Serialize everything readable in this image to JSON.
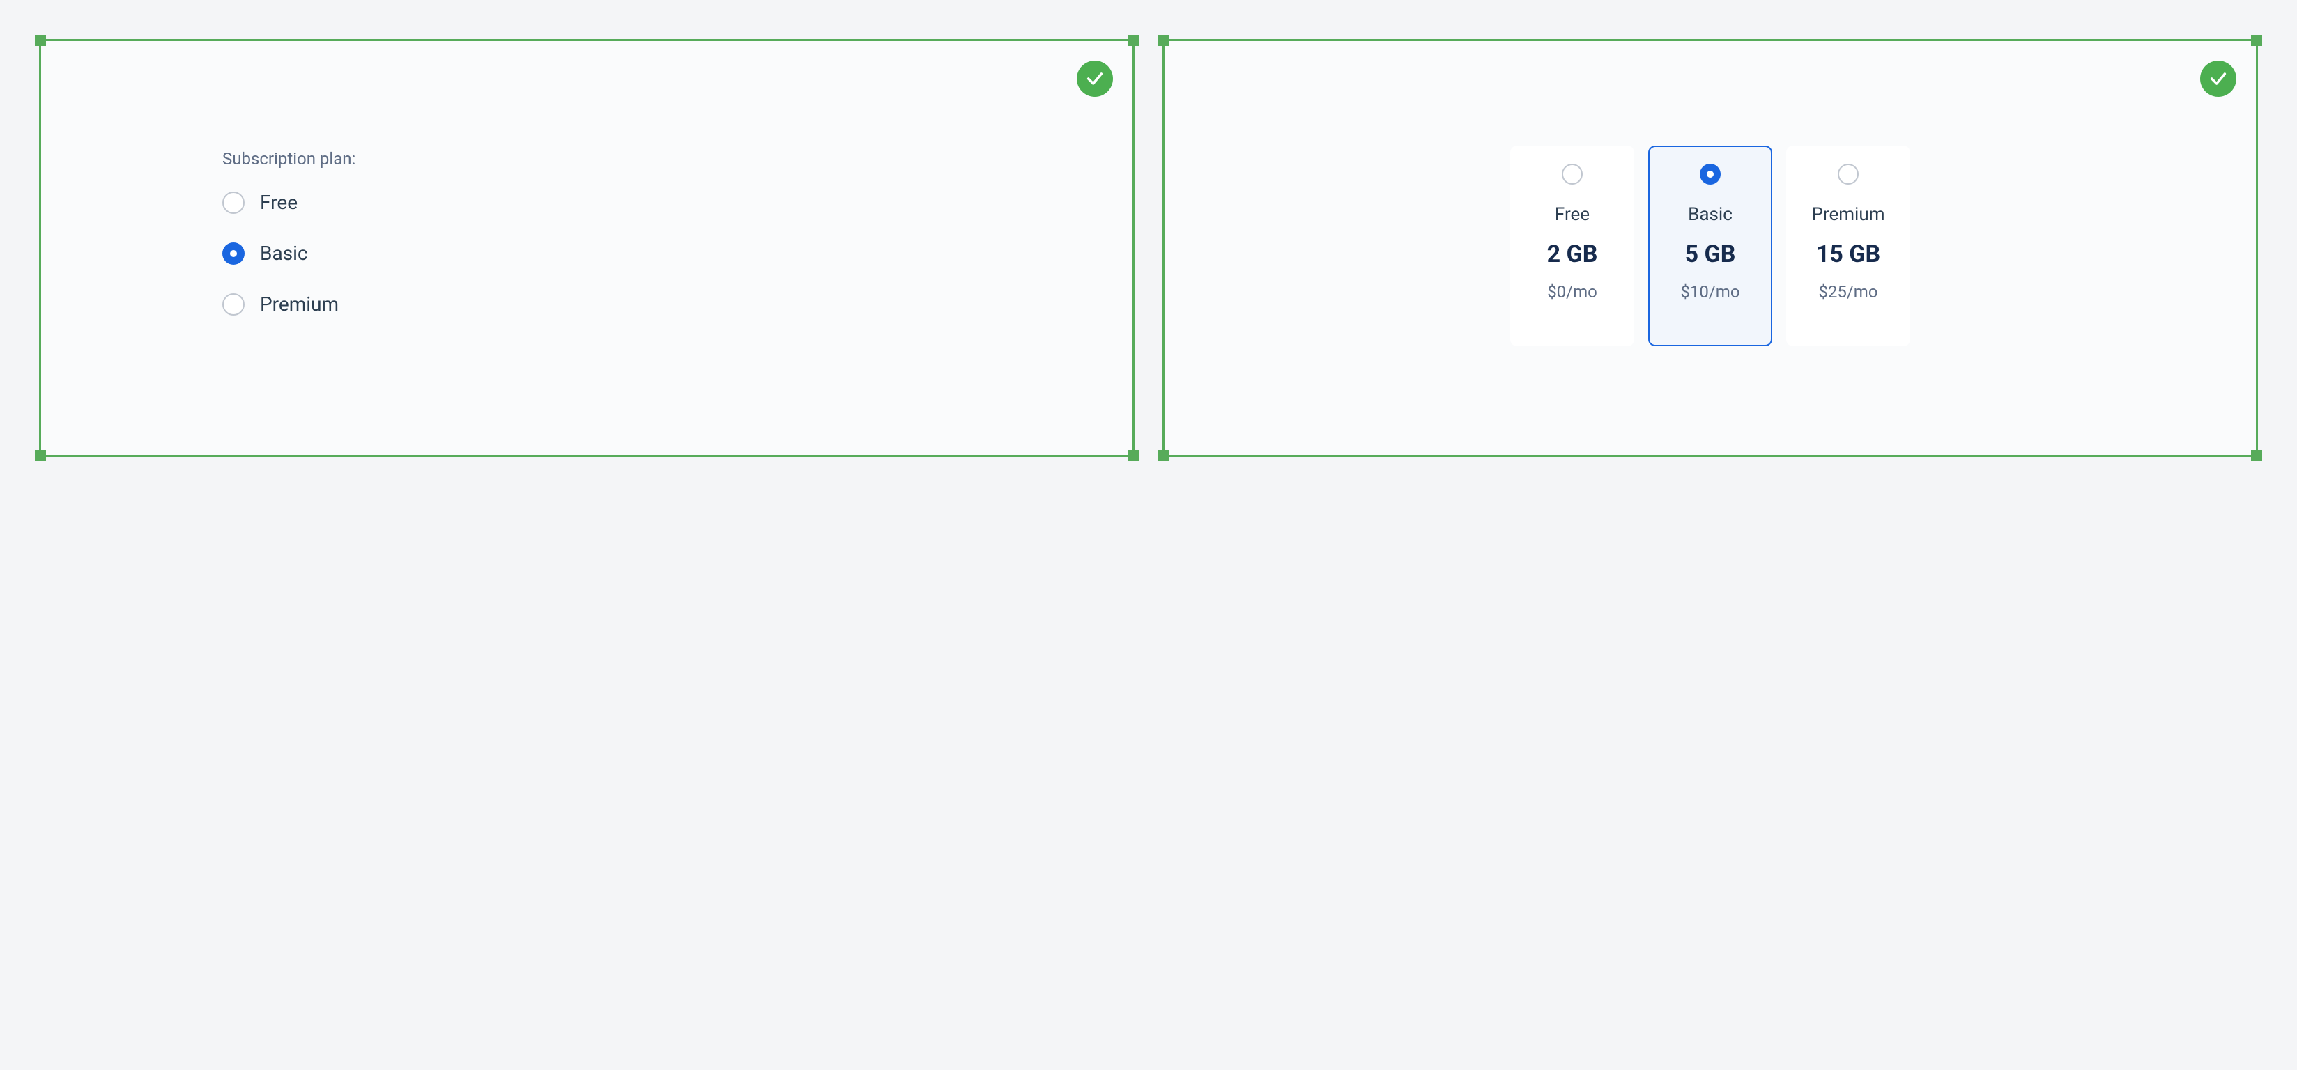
{
  "panel1": {
    "group_label": "Subscription plan:",
    "options": [
      {
        "label": "Free",
        "selected": false
      },
      {
        "label": "Basic",
        "selected": true
      },
      {
        "label": "Premium",
        "selected": false
      }
    ]
  },
  "panel2": {
    "plans": [
      {
        "name": "Free",
        "storage": "2 GB",
        "price": "$0/mo",
        "selected": false
      },
      {
        "name": "Basic",
        "storage": "5 GB",
        "price": "$10/mo",
        "selected": true
      },
      {
        "name": "Premium",
        "storage": "15 GB",
        "price": "$25/mo",
        "selected": false
      }
    ]
  },
  "colors": {
    "accent_green": "#57ab5a",
    "badge_green": "#4caf50",
    "radio_blue": "#1a66e0"
  }
}
